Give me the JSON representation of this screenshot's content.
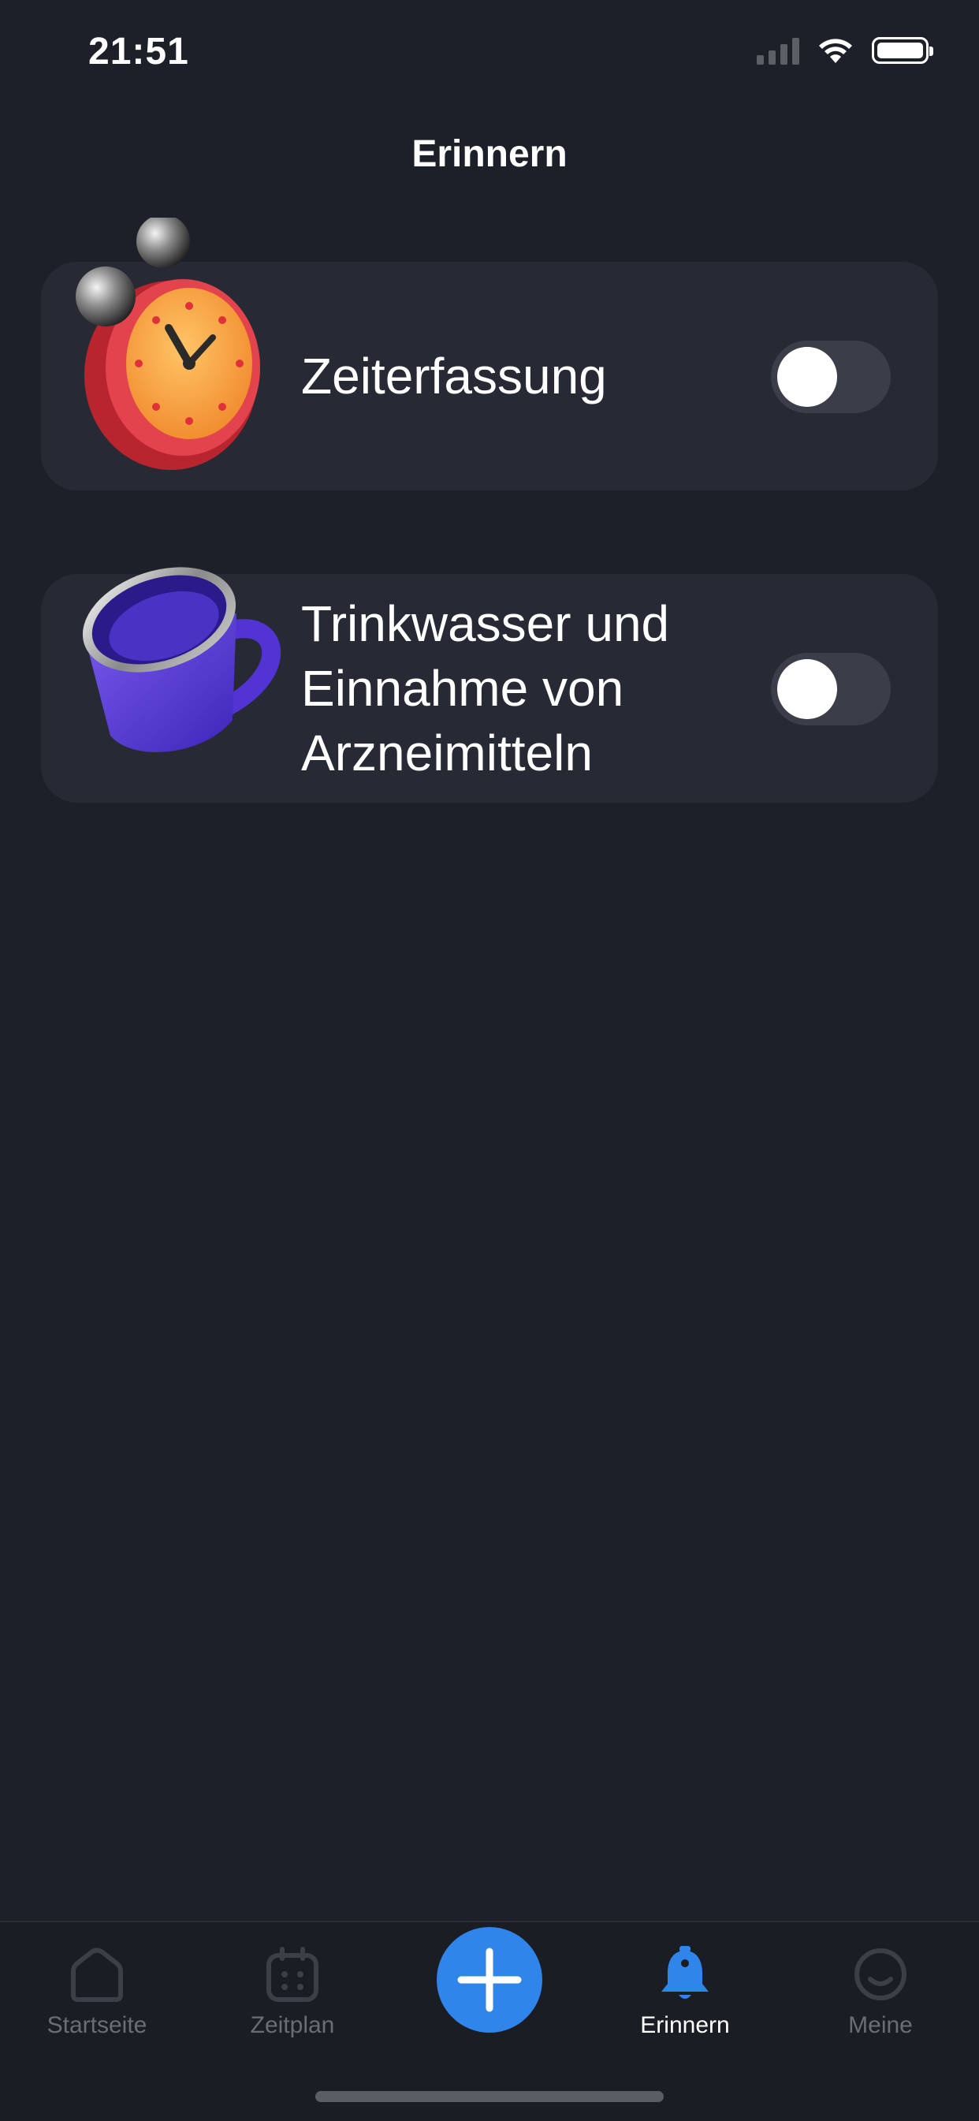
{
  "status_bar": {
    "time": "21:51",
    "icons": [
      "signal-icon",
      "wifi-icon",
      "battery-icon"
    ]
  },
  "header": {
    "title": "Erinnern"
  },
  "reminders": [
    {
      "label": "Zeiterfassung",
      "icon": "alarm-clock-icon",
      "enabled": false
    },
    {
      "label": "Trinkwasser und Einnahme von Arzneimitteln",
      "icon": "mug-icon",
      "enabled": false
    }
  ],
  "tab_bar": {
    "tabs": [
      {
        "label": "Startseite",
        "icon": "home-icon",
        "active": false
      },
      {
        "label": "Zeitplan",
        "icon": "calendar-icon",
        "active": false
      },
      {
        "label": "Erinnern",
        "icon": "bell-icon",
        "active": true
      },
      {
        "label": "Meine",
        "icon": "smiley-icon",
        "active": false
      }
    ],
    "add_button_icon": "plus-icon"
  },
  "colors": {
    "background": "#1e2029",
    "card": "#272a34",
    "accent": "#2f85e9",
    "toggle_off": "#3b3e48",
    "tab_inactive": "#6a6d76"
  }
}
